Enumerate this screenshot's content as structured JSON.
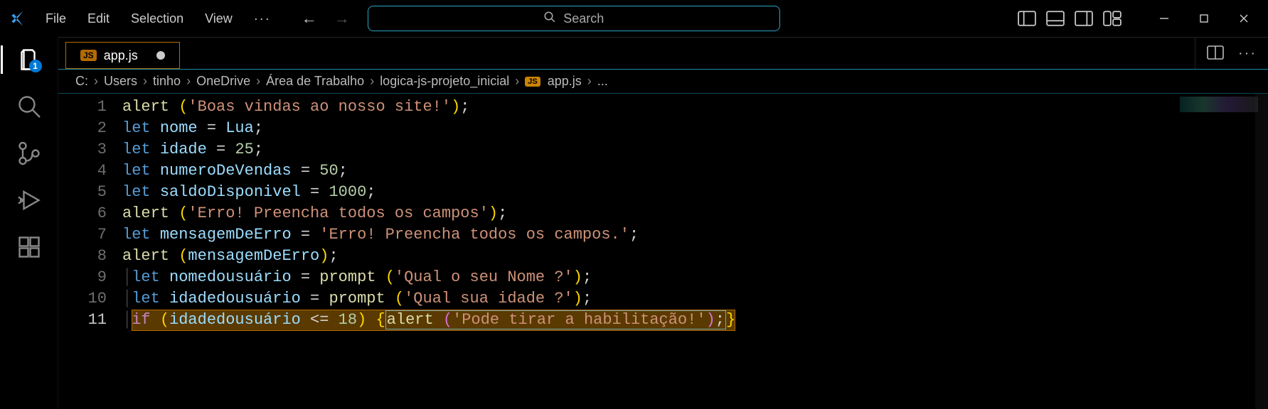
{
  "menu": {
    "file": "File",
    "edit": "Edit",
    "selection": "Selection",
    "view": "View",
    "more": "···"
  },
  "search": {
    "placeholder": "Search"
  },
  "activity": {
    "explorer_badge": "1"
  },
  "tab": {
    "filename": "app.js",
    "lang_badge": "JS"
  },
  "breadcrumb": {
    "parts": [
      "C:",
      "Users",
      "tinho",
      "OneDrive",
      "Área de Trabalho",
      "logica-js-projeto_inicial"
    ],
    "file_badge": "JS",
    "file": "app.js",
    "tail": "..."
  },
  "editor": {
    "line_count": 11,
    "active_line": 11,
    "tokens": {
      "alert": "alert",
      "let": "let",
      "if": "if",
      "prompt": "prompt",
      "nome": "nome",
      "Lua": "Lua",
      "idade": "idade",
      "numeroDeVendas": "numeroDeVendas",
      "saldoDisponivel": "saldoDisponivel",
      "mensagemDeErro": "mensagemDeErro",
      "nomedousuario": "nomedousuário",
      "idadedousuario": "idadedousuário",
      "n25": "25",
      "n50": "50",
      "n1000": "1000",
      "n18": "18",
      "s1": "'Boas vindas ao nosso site!'",
      "s2": "'Erro! Preencha todos os campos'",
      "s3": "'Erro! Preencha todos os campos.'",
      "s4": "'Qual o seu Nome ?'",
      "s5": "'Qual sua idade ?'",
      "s6": "'Pode tirar a habilitação!'",
      "eq": " = ",
      "le": " <= ",
      "semi": ";",
      "sp": " "
    }
  }
}
